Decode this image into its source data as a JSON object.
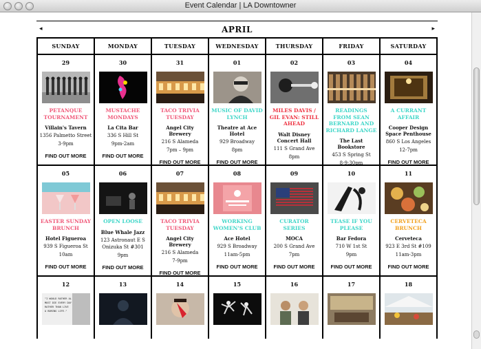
{
  "window": {
    "title": "Event Calendar | LA Downtowner"
  },
  "calendar": {
    "month": "APRIL",
    "prev_arrow": "◂",
    "next_arrow": "▸",
    "days": [
      "SUNDAY",
      "MONDAY",
      "TUESDAY",
      "WEDNESDAY",
      "THURSDAY",
      "FRIDAY",
      "SATURDAY"
    ],
    "find_out_more": "FIND OUT MORE",
    "colors": {
      "pink": "#f05a7a",
      "red": "#ee3342",
      "teal": "#3fd6c8",
      "orange": "#f2a11e",
      "border": "#000000"
    },
    "weeks": [
      [
        {
          "day": "29",
          "title": "PETANQUE TOURNAMENT",
          "venue": "Villain's Tavern",
          "addr": "1356 Palmetto Street",
          "time": "3-9pm",
          "color": "#f05a7a",
          "img": "people-photo"
        },
        {
          "day": "30",
          "title": "MUSTACHE MONDAYS",
          "venue": "La Cita Bar",
          "addr": "336 S Hill St",
          "time": "9pm-2am",
          "color": "#f05a7a",
          "img": "pink-figure-photo"
        },
        {
          "day": "31",
          "title": "TACO TRIVIA TUESDAY",
          "venue": "Angel City Brewery",
          "addr": "216 S Alameda",
          "time": "7pm – 9pm",
          "color": "#f05a7a",
          "img": "brewery-photo"
        },
        {
          "day": "01",
          "title": "MUSIC OF DAVID LYNCH",
          "venue": "Theatre at Ace Hotel",
          "addr": "929 Broadway",
          "time": "8pm",
          "color": "#3fd6c8",
          "img": "portrait-photo"
        },
        {
          "day": "02",
          "title": "MILES DAVIS / GIL EVAN: STILL AHEAD",
          "venue": "Walt Disney Concert Hall",
          "addr": "111 S Grand Ave",
          "time": "8pm",
          "color": "#ee3342",
          "img": "trumpet-photo"
        },
        {
          "day": "03",
          "title": "READINGS FROM SEAN BERNARD AND RICHARD LANGE",
          "venue": "The Last Bookstore",
          "addr": "453 S Spring St",
          "time": "8-9:30pm",
          "color": "#3fd6c8",
          "img": "bookstore-photo"
        },
        {
          "day": "04",
          "title": "A CURRANT AFFAIR",
          "venue": "Cooper Design Space Penthouse",
          "addr": "860 S Los Angeles",
          "time": "12-7pm",
          "color": "#3fd6c8",
          "img": "interior-photo"
        }
      ],
      [
        {
          "day": "05",
          "title": "EASTER SUNDAY BRUNCH",
          "venue": "Hotel Figueroa",
          "addr": "939 S Figueroa St",
          "time": "10am",
          "color": "#f05a7a",
          "img": "drinks-photo"
        },
        {
          "day": "06",
          "title": "OPEN LOOSE",
          "venue": "Blue Whale Jazz",
          "addr": "123 Astronaut E S Onizuka St #301",
          "time": "9pm",
          "color": "#3fd6c8",
          "img": "stage-photo"
        },
        {
          "day": "07",
          "title": "TACO TRIVIA TUESDAY",
          "venue": "Angel City Brewery",
          "addr": "216 S Alameda",
          "time": "7-9pm",
          "color": "#f05a7a",
          "img": "brewery-photo"
        },
        {
          "day": "08",
          "title": "WORKING WOMEN'S CLUB",
          "venue": "Ace Hotel",
          "addr": "929 S Broadway",
          "time": "11am-5pm",
          "color": "#3fd6c8",
          "img": "poster-photo"
        },
        {
          "day": "09",
          "title": "CURATOR SERIES",
          "venue": "MOCA",
          "addr": "200 S Grand Ave",
          "time": "7pm",
          "color": "#3fd6c8",
          "img": "flag-photo"
        },
        {
          "day": "10",
          "title": "TEASE IF YOU PLEASE",
          "venue": "Bar Fedora",
          "addr": "710 W 1st St",
          "time": "9pm",
          "color": "#3fd6c8",
          "img": "dancer-photo"
        },
        {
          "day": "11",
          "title": "CERVETECA BRUNCH",
          "venue": "Cerveteca",
          "addr": "923 E 3rd St #109",
          "time": "11am-3pm",
          "color": "#f2a11e",
          "img": "food-photo"
        }
      ],
      [
        {
          "day": "12",
          "img": "quote-card-photo",
          "quote": "\"I WOULD RATHER ALMOST DIE EVERY DAY RATHER THAN LIVE A BORING LIFE.\""
        },
        {
          "day": "13",
          "img": "dark-figure-photo"
        },
        {
          "day": "14",
          "img": "face-paint-photo"
        },
        {
          "day": "15",
          "img": "dance-photo"
        },
        {
          "day": "16",
          "img": "musicians-photo"
        },
        {
          "day": "17",
          "img": "room-photo"
        },
        {
          "day": "18",
          "img": "market-photo"
        }
      ]
    ]
  }
}
